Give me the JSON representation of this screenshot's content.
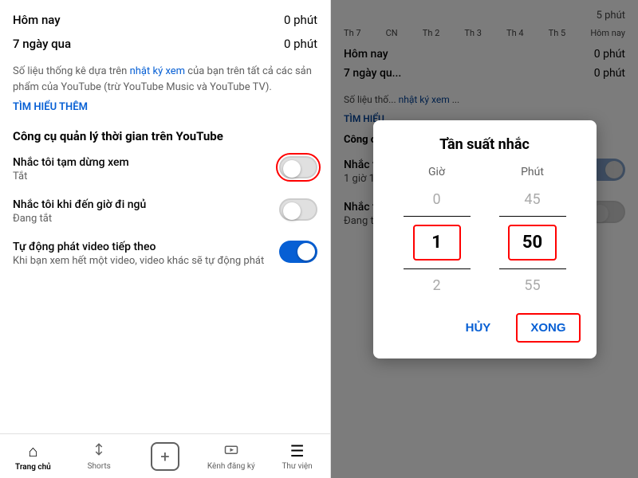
{
  "left": {
    "stats": [
      {
        "label": "Hôm nay",
        "value": "0 phút"
      },
      {
        "label": "7 ngày qua",
        "value": "0 phút"
      }
    ],
    "description": "Số liệu thống kê dựa trên nhật ký xem của bạn trên tất cả các sản phẩm của YouTube (trừ YouTube Music và YouTube TV).",
    "learn_more": "TÌM HIỂU THÊM",
    "section_title": "Công cụ quản lý thời gian trên YouTube",
    "settings": [
      {
        "name": "Nhắc tôi tạm dừng xem",
        "sub": "Tắt",
        "toggle": "off",
        "red_border": true
      },
      {
        "name": "Nhắc tôi khi đến giờ đi ngủ",
        "sub": "Đang tắt",
        "toggle": "off",
        "red_border": false
      },
      {
        "name": "Tự động phát video tiếp theo",
        "sub": "Khi bạn xem hết một video, video khác sẽ tự động phát",
        "toggle": "on",
        "red_border": false
      }
    ]
  },
  "nav": {
    "items": [
      {
        "label": "Trang chủ",
        "icon": "⌂",
        "active": true
      },
      {
        "label": "Shorts",
        "icon": "✂",
        "active": false
      },
      {
        "label": "",
        "icon": "+",
        "active": false,
        "is_add": true
      },
      {
        "label": "Kênh đăng ký",
        "icon": "▶",
        "active": false
      },
      {
        "label": "Thư viện",
        "icon": "☰",
        "active": false
      }
    ]
  },
  "right": {
    "top_value": "5 phút",
    "days": [
      "Th 7",
      "CN",
      "Th 2",
      "Th 3",
      "Th 4",
      "Th 5",
      "Hôm nay"
    ],
    "stats": [
      {
        "label": "Hôm nay",
        "value": "0 phút"
      },
      {
        "label": "7 ngày qu...",
        "value": "0 phút"
      }
    ],
    "desc_partial": "Số liệu thố...",
    "learn_partial": "TÌM HIỂU...",
    "congcu_partial": "Công cụ...",
    "nhac_partial": "Nhắc tôi...",
    "nhac_sub_partial": "1 giờ 15 p...",
    "nhac_ngu": "Nhắc tôi khi đến giờ đi ngủ",
    "nhac_ngu_sub": "Đang tắt"
  },
  "modal": {
    "title": "Tần suất nhắc",
    "col_gio": "Giờ",
    "col_phut": "Phút",
    "picker_gio": [
      "0",
      "1",
      "2"
    ],
    "picker_phut": [
      "45",
      "50",
      "55"
    ],
    "selected_gio": "1",
    "selected_phut": "50",
    "btn_cancel": "HỦY",
    "btn_done": "XONG"
  }
}
